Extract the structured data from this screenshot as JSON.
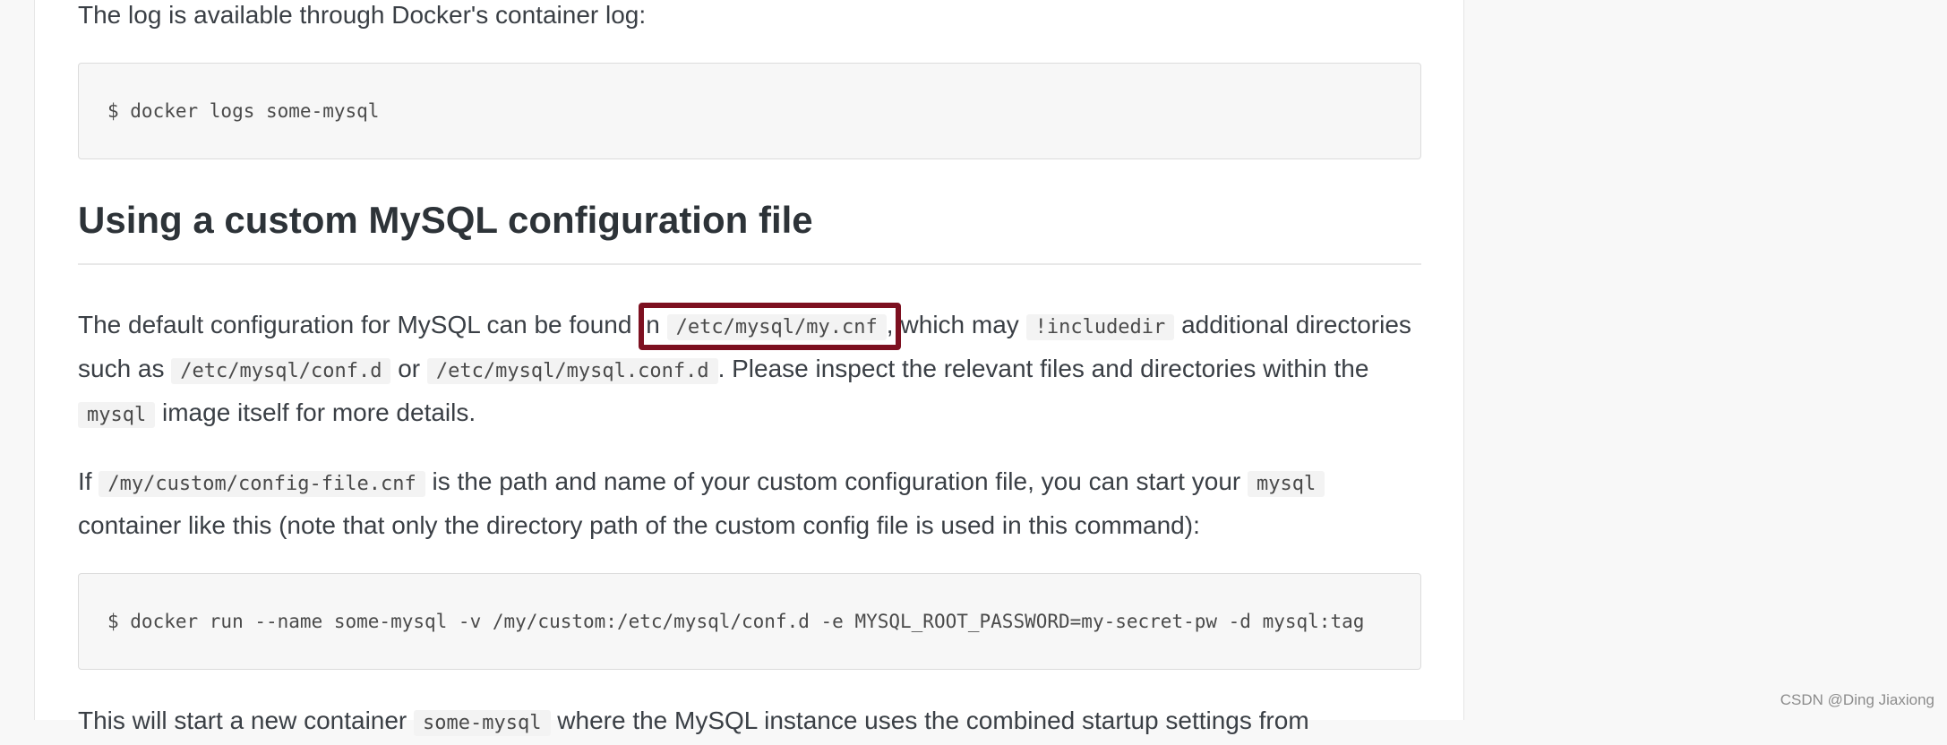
{
  "intro": {
    "text": "The log is available through Docker's container log:"
  },
  "code1": {
    "text": "$ docker logs some-mysql"
  },
  "heading": {
    "text": "Using a custom MySQL configuration file"
  },
  "para1": {
    "part1": "The default configuration for MySQL can be found ",
    "highlight_prefix": "n ",
    "code_mycnf": "/etc/mysql/my.cnf",
    "highlight_suffix": ",",
    "part2": "which may ",
    "code_includedir": "!includedir",
    "part3": " additional directories",
    "line2_part1": "such as ",
    "code_confd": "/etc/mysql/conf.d",
    "line2_part2": " or ",
    "code_mysqlconfd": "/etc/mysql/mysql.conf.d",
    "line2_part3": ". Please inspect the relevant files and directories within the",
    "code_mysql": "mysql",
    "line3_part1": " image itself for more details."
  },
  "para2": {
    "part1": "If ",
    "code_custom": "/my/custom/config-file.cnf",
    "part2": " is the path and name of your custom configuration file, you can start your ",
    "code_mysql": "mysql",
    "line2": "container like this (note that only the directory path of the custom config file is used in this command):"
  },
  "code2": {
    "text": "$ docker run --name some-mysql -v /my/custom:/etc/mysql/conf.d -e MYSQL_ROOT_PASSWORD=my-secret-pw -d mysql:tag"
  },
  "para3": {
    "part1": "This will start a new container ",
    "code_some": "some-mysql",
    "part2": " where the MySQL instance uses the combined startup settings from"
  },
  "watermark": {
    "text": "CSDN @Ding Jiaxiong"
  },
  "colors": {
    "highlight_border": "#7d1020",
    "code_background": "#f7f7f7"
  }
}
